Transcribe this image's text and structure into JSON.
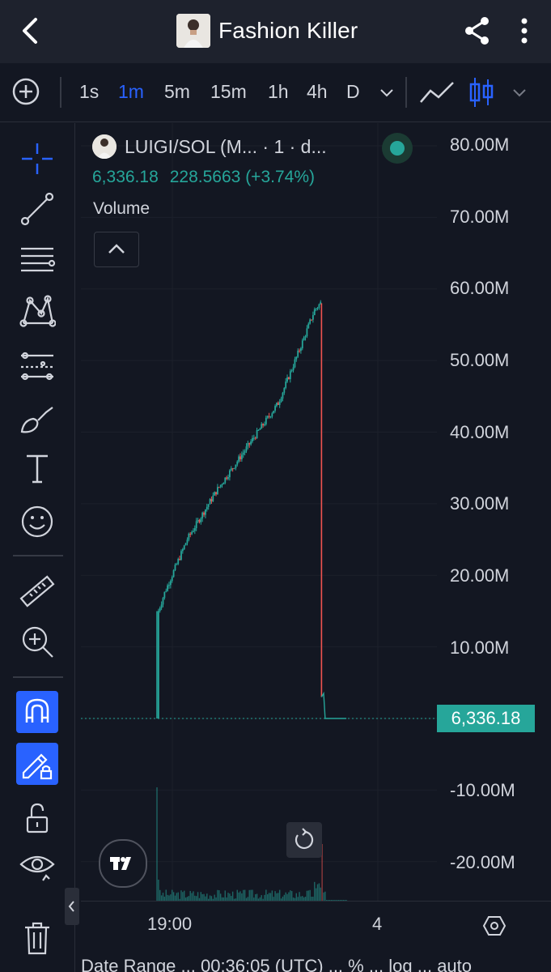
{
  "header": {
    "title": "Fashion Killer",
    "back_icon": "back-chevron-icon",
    "share_icon": "share-icon",
    "more_icon": "more-vertical-icon"
  },
  "timeframes": {
    "items": [
      "1s",
      "1m",
      "5m",
      "15m",
      "1h",
      "4h",
      "D"
    ],
    "active": "1m"
  },
  "toolbar_icons": [
    "crosshair-icon",
    "trend-line-icon",
    "fib-lines-icon",
    "pattern-icon",
    "prediction-icon",
    "brush-icon",
    "text-tool-icon",
    "emoji-icon",
    "ruler-icon",
    "zoom-in-icon",
    "magnet-icon",
    "lock-drawing-icon",
    "unlock-icon",
    "eye-icon",
    "trash-icon"
  ],
  "legend": {
    "symbol": "LUIGI/SOL (M... · 1 · d...",
    "last": "6,336.18",
    "change": "228.5663",
    "change_pct": "(+3.74%)",
    "volume_label": "Volume"
  },
  "price_axis": {
    "labels": [
      "80.00M",
      "70.00M",
      "60.00M",
      "50.00M",
      "40.00M",
      "30.00M",
      "20.00M",
      "10.00M",
      "-10.00M",
      "-20.00M"
    ],
    "current_price": "6,336.18"
  },
  "time_axis": {
    "labels": [
      "19:00",
      "4"
    ]
  },
  "footer_peek": "Date Range   ...   00:36:05 (UTC)   ...   % ... log ... auto",
  "colors": {
    "up": "#26a69a",
    "down": "#ef5350",
    "accent": "#2962ff",
    "background": "#131722"
  },
  "chart_data": {
    "type": "candlestick",
    "series_type": "price",
    "ylim": [
      -25000000,
      85000000
    ],
    "current_price": 6336.18,
    "notes_values": [
      {
        "t": 0,
        "v": 6336
      },
      {
        "t": 1,
        "v": 15000000
      },
      {
        "t": 5,
        "v": 17500000
      },
      {
        "t": 10,
        "v": 20000000
      },
      {
        "t": 20,
        "v": 25000000
      },
      {
        "t": 40,
        "v": 32000000
      },
      {
        "t": 60,
        "v": 38000000
      },
      {
        "t": 80,
        "v": 44000000
      },
      {
        "t": 95,
        "v": 52000000
      },
      {
        "t": 104,
        "v": 57000000
      },
      {
        "t": 108,
        "v": 58000000
      },
      {
        "t": 109,
        "v": 3000000
      },
      {
        "t": 110,
        "v": 6336
      }
    ]
  }
}
